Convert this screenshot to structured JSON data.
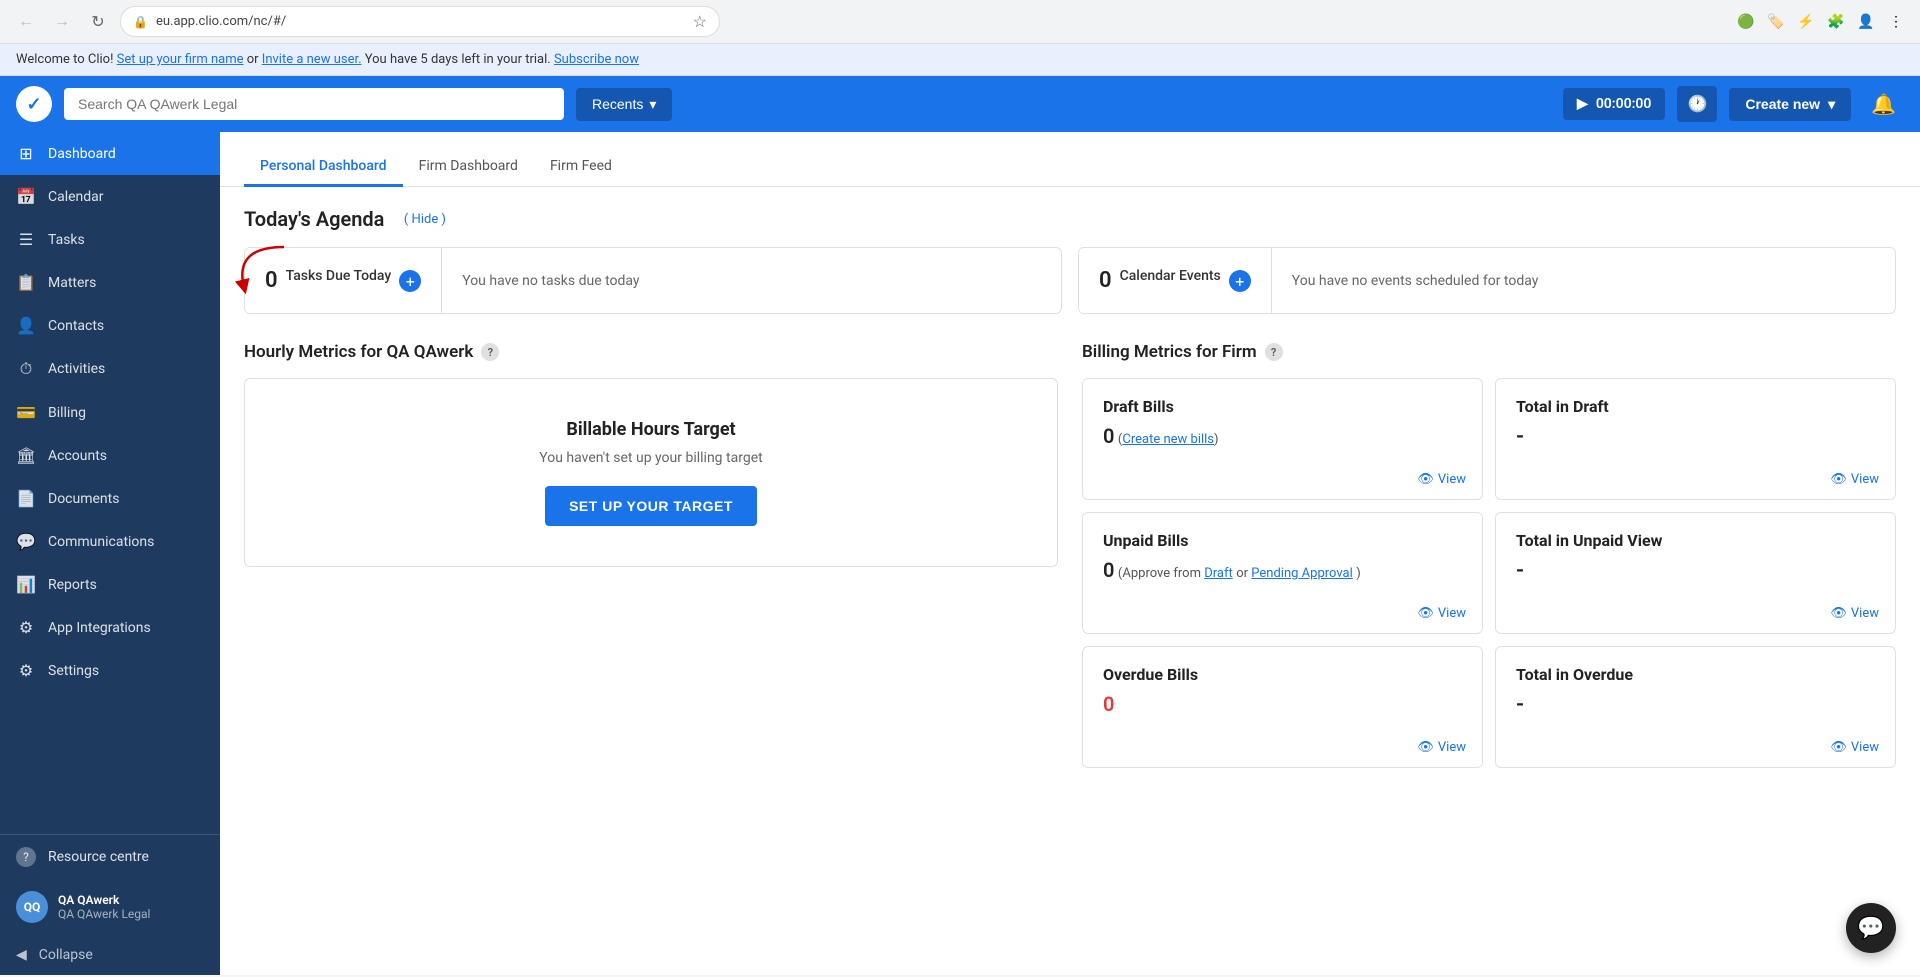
{
  "browser": {
    "back_disabled": true,
    "forward_disabled": true,
    "url": "eu.app.clio.com/nc/#/",
    "extensions": [
      "🟢",
      "🏷️",
      "⚡",
      "🧩"
    ]
  },
  "banner": {
    "text_prefix": "Welcome to Clio! ",
    "link1": "Set up your firm name",
    "text_middle": " or ",
    "link2": "Invite a new user.",
    "text_suffix": " You have 5 days left in your trial. ",
    "link3": "Subscribe now"
  },
  "topnav": {
    "search_placeholder": "Search QA QAwerk Legal",
    "recents_label": "Recents",
    "timer_value": "00:00:00",
    "create_new_label": "Create new",
    "logo_text": "✓"
  },
  "sidebar": {
    "items": [
      {
        "id": "dashboard",
        "label": "Dashboard",
        "icon": "⊞",
        "active": true
      },
      {
        "id": "calendar",
        "label": "Calendar",
        "icon": "📅",
        "active": false
      },
      {
        "id": "tasks",
        "label": "Tasks",
        "icon": "☰",
        "active": false
      },
      {
        "id": "matters",
        "label": "Matters",
        "icon": "📋",
        "active": false
      },
      {
        "id": "contacts",
        "label": "Contacts",
        "icon": "👤",
        "active": false
      },
      {
        "id": "activities",
        "label": "Activities",
        "icon": "⏱",
        "active": false
      },
      {
        "id": "billing",
        "label": "Billing",
        "icon": "💳",
        "active": false
      },
      {
        "id": "accounts",
        "label": "Accounts",
        "icon": "🏛",
        "active": false
      },
      {
        "id": "documents",
        "label": "Documents",
        "icon": "📄",
        "active": false
      },
      {
        "id": "communications",
        "label": "Communications",
        "icon": "💬",
        "active": false
      },
      {
        "id": "reports",
        "label": "Reports",
        "icon": "📊",
        "active": false
      },
      {
        "id": "app-integrations",
        "label": "App Integrations",
        "icon": "⚙",
        "active": false
      },
      {
        "id": "settings",
        "label": "Settings",
        "icon": "⚙",
        "active": false
      }
    ],
    "resource_centre_label": "Resource centre",
    "user": {
      "name": "QA QAwerk",
      "firm": "QA QAwerk Legal",
      "initials": "QQ"
    },
    "collapse_label": "Collapse"
  },
  "tabs": [
    {
      "id": "personal",
      "label": "Personal Dashboard",
      "active": true
    },
    {
      "id": "firm",
      "label": "Firm Dashboard",
      "active": false
    },
    {
      "id": "feed",
      "label": "Firm Feed",
      "active": false
    }
  ],
  "agenda": {
    "title": "Today's Agenda",
    "hide_label": "( Hide )",
    "tasks": {
      "count": "0",
      "label": "Tasks Due Today",
      "empty_msg": "You have no tasks due today"
    },
    "events": {
      "count": "0",
      "label": "Calendar Events",
      "empty_msg": "You have no events scheduled for today"
    }
  },
  "hourly_metrics": {
    "title": "Hourly Metrics for QA QAwerk",
    "help": "?",
    "billable_target": {
      "title": "Billable Hours Target",
      "subtitle": "You haven't set up your billing target",
      "button_label": "SET UP YOUR TARGET"
    }
  },
  "billing_metrics": {
    "title": "Billing Metrics for Firm",
    "help": "?",
    "draft_bills": {
      "title": "Draft Bills",
      "count": "0",
      "count_label": "",
      "link_label": "Create new bills",
      "view_label": "View"
    },
    "total_in_draft": {
      "title": "Total in Draft",
      "value": "-",
      "view_label": "View"
    },
    "unpaid_bills": {
      "title": "Unpaid Bills",
      "count": "0",
      "approve_text": "Approve from",
      "draft_link": "Draft",
      "or_text": "or",
      "pending_link": "Pending Approval",
      "view_label": "View"
    },
    "total_in_unpaid": {
      "title": "Total in Unpaid View",
      "value": "-",
      "view_label": "View"
    },
    "overdue_bills": {
      "title": "Overdue Bills",
      "count": "0",
      "view_label": "View"
    },
    "total_in_overdue": {
      "title": "Total in Overdue",
      "value": "-",
      "view_label": "View"
    }
  },
  "colors": {
    "primary": "#1a73e8",
    "sidebar_bg": "#1e3a5f",
    "active_nav": "#1a73e8",
    "red": "#e53935"
  }
}
